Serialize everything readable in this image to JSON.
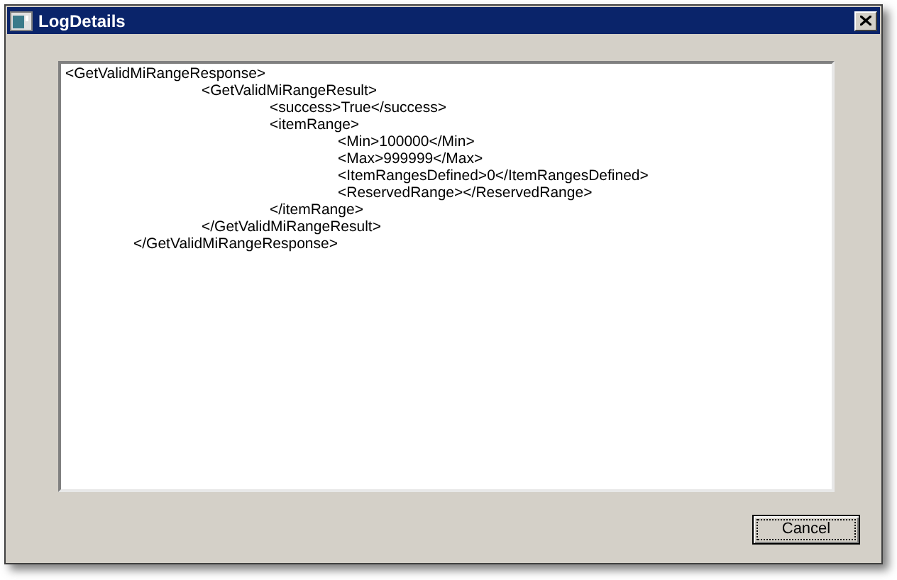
{
  "window": {
    "title": "LogDetails"
  },
  "log_lines": [
    "<GetValidMiRangeResponse>",
    "\t\t<GetValidMiRangeResult>",
    "\t\t\t<success>True</success>",
    "\t\t\t<itemRange>",
    "\t\t\t\t<Min>100000</Min>",
    "\t\t\t\t<Max>999999</Max>",
    "\t\t\t\t<ItemRangesDefined>0</ItemRangesDefined>",
    "\t\t\t\t<ReservedRange></ReservedRange>",
    "\t\t\t</itemRange>",
    "\t\t</GetValidMiRangeResult>",
    "\t</GetValidMiRangeResponse>"
  ],
  "buttons": [
    "Cancel"
  ]
}
